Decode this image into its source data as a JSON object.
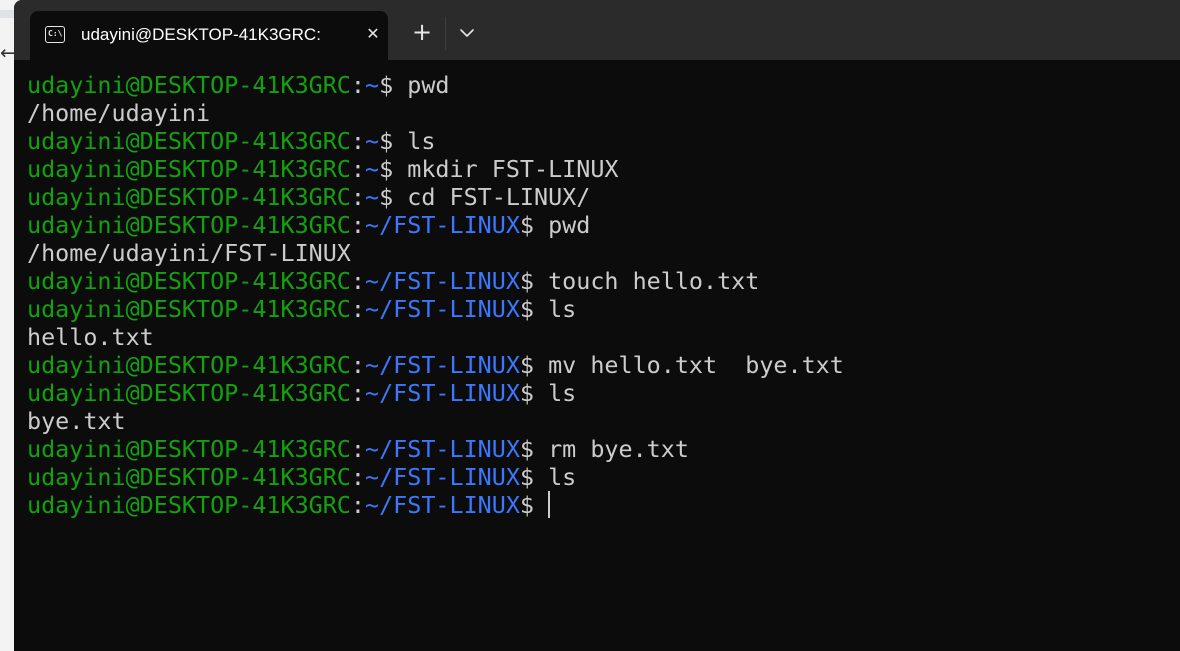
{
  "background": {
    "back_icon": "arrow-left-icon"
  },
  "tab": {
    "icon": "terminal-icon",
    "icon_glyph": "C:\\",
    "title": "udayini@DESKTOP-41K3GRC:",
    "close_icon": "close-icon"
  },
  "titlebar": {
    "new_tab_icon": "plus-icon",
    "dropdown_icon": "chevron-down-icon"
  },
  "colors": {
    "user": "#13a10e",
    "path": "#3b78ff",
    "text": "#cccccc",
    "background": "#0c0c0c",
    "titlebar": "#2b2b2b"
  },
  "terminal": {
    "lines": [
      {
        "type": "prompt",
        "user": "udayini@DESKTOP-41K3GRC",
        "colon": ":",
        "path": "~",
        "dollar": "$",
        "command": " pwd"
      },
      {
        "type": "output",
        "text": "/home/udayini"
      },
      {
        "type": "prompt",
        "user": "udayini@DESKTOP-41K3GRC",
        "colon": ":",
        "path": "~",
        "dollar": "$",
        "command": " ls"
      },
      {
        "type": "prompt",
        "user": "udayini@DESKTOP-41K3GRC",
        "colon": ":",
        "path": "~",
        "dollar": "$",
        "command": " mkdir FST-LINUX"
      },
      {
        "type": "prompt",
        "user": "udayini@DESKTOP-41K3GRC",
        "colon": ":",
        "path": "~",
        "dollar": "$",
        "command": " cd FST-LINUX/"
      },
      {
        "type": "prompt",
        "user": "udayini@DESKTOP-41K3GRC",
        "colon": ":",
        "path": "~/FST-LINUX",
        "dollar": "$",
        "command": " pwd"
      },
      {
        "type": "output",
        "text": "/home/udayini/FST-LINUX"
      },
      {
        "type": "prompt",
        "user": "udayini@DESKTOP-41K3GRC",
        "colon": ":",
        "path": "~/FST-LINUX",
        "dollar": "$",
        "command": " touch hello.txt"
      },
      {
        "type": "prompt",
        "user": "udayini@DESKTOP-41K3GRC",
        "colon": ":",
        "path": "~/FST-LINUX",
        "dollar": "$",
        "command": " ls"
      },
      {
        "type": "output",
        "text": "hello.txt"
      },
      {
        "type": "prompt",
        "user": "udayini@DESKTOP-41K3GRC",
        "colon": ":",
        "path": "~/FST-LINUX",
        "dollar": "$",
        "command": " mv hello.txt  bye.txt"
      },
      {
        "type": "prompt",
        "user": "udayini@DESKTOP-41K3GRC",
        "colon": ":",
        "path": "~/FST-LINUX",
        "dollar": "$",
        "command": " ls"
      },
      {
        "type": "output",
        "text": "bye.txt"
      },
      {
        "type": "prompt",
        "user": "udayini@DESKTOP-41K3GRC",
        "colon": ":",
        "path": "~/FST-LINUX",
        "dollar": "$",
        "command": " rm bye.txt"
      },
      {
        "type": "prompt",
        "user": "udayini@DESKTOP-41K3GRC",
        "colon": ":",
        "path": "~/FST-LINUX",
        "dollar": "$",
        "command": " ls"
      },
      {
        "type": "prompt",
        "user": "udayini@DESKTOP-41K3GRC",
        "colon": ":",
        "path": "~/FST-LINUX",
        "dollar": "$",
        "command": "",
        "cursor": true
      }
    ]
  }
}
